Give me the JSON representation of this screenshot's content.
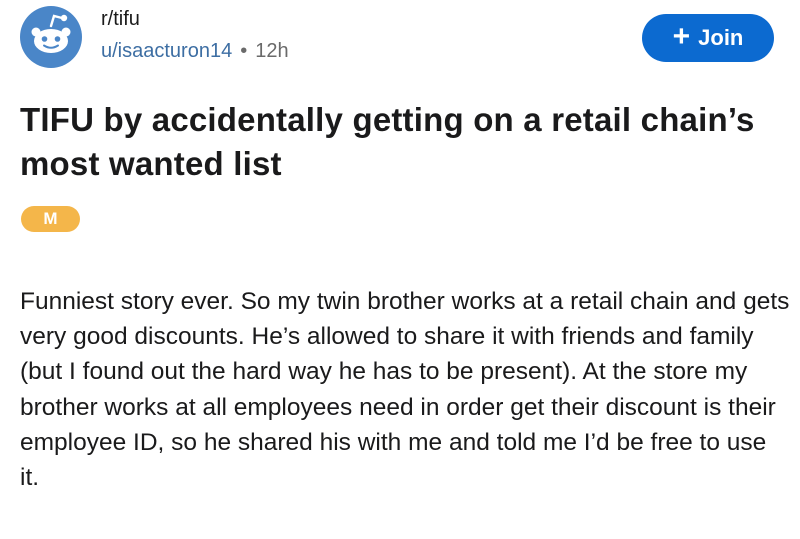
{
  "post": {
    "subreddit": "r/tifu",
    "author": "u/isaacturon14",
    "separator": "•",
    "age": "12h",
    "join_label": "Join",
    "join_icon": "plus-icon",
    "avatar_icon": "reddit-snoo-icon",
    "title": "TIFU by accidentally getting on a retail chain’s most wanted list",
    "flair": "M",
    "body": "Funniest story ever. So my twin brother works at a retail chain and gets very good discounts. He’s allowed to share it with friends and family (but I found out the hard way he has to be present). At the store my brother works at all employees need in order get their discount is their employee ID, so he shared his with me and told me I’d be free to use it."
  },
  "colors": {
    "accent": "#0c6ad0",
    "username": "#3d6ea3",
    "flair": "#f4b64a",
    "avatar_bg": "#4a86c8"
  }
}
